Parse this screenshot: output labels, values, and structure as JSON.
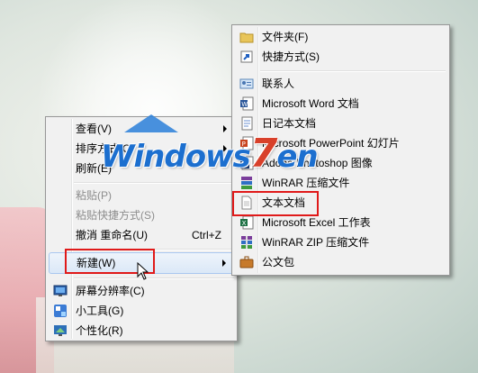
{
  "watermark": {
    "part1": "Windows",
    "part2": "7",
    "part3": "en"
  },
  "context_menu": {
    "items": [
      {
        "label": "查看(V)",
        "submenu": true
      },
      {
        "label": "排序方式(O)",
        "submenu": true
      },
      {
        "label": "刷新(E)"
      },
      {
        "label": "粘贴(P)",
        "disabled": true
      },
      {
        "label": "粘贴快捷方式(S)",
        "disabled": true
      },
      {
        "label": "撤消 重命名(U)",
        "shortcut": "Ctrl+Z"
      },
      {
        "label": "新建(W)",
        "submenu": true,
        "highlighted": true
      },
      {
        "label": "屏幕分辨率(C)",
        "icon": "monitor-icon"
      },
      {
        "label": "小工具(G)",
        "icon": "gadget-icon"
      },
      {
        "label": "个性化(R)",
        "icon": "personalize-icon"
      }
    ]
  },
  "submenu": {
    "items": [
      {
        "label": "文件夹(F)",
        "icon": "folder-icon"
      },
      {
        "label": "快捷方式(S)",
        "icon": "shortcut-icon"
      },
      {
        "label": "联系人",
        "icon": "contact-icon"
      },
      {
        "label": "Microsoft Word 文档",
        "icon": "word-doc-icon"
      },
      {
        "label": "日记本文档",
        "icon": "journal-icon"
      },
      {
        "label": "Microsoft PowerPoint 幻灯片",
        "icon": "powerpoint-icon"
      },
      {
        "label": "Adobe Photoshop 图像",
        "icon": "photoshop-icon"
      },
      {
        "label": "WinRAR 压缩文件",
        "icon": "winrar-icon"
      },
      {
        "label": "文本文档",
        "icon": "text-doc-icon",
        "highlighted": true
      },
      {
        "label": "Microsoft Excel 工作表",
        "icon": "excel-icon"
      },
      {
        "label": "WinRAR ZIP 压缩文件",
        "icon": "winrar-zip-icon"
      },
      {
        "label": "公文包",
        "icon": "briefcase-icon"
      }
    ]
  },
  "colors": {
    "highlight_box": "#e01a1a",
    "menu_bg": "#f1f1f1",
    "watermark_blue": "#1c6fcf",
    "watermark_red": "#d8402a"
  }
}
